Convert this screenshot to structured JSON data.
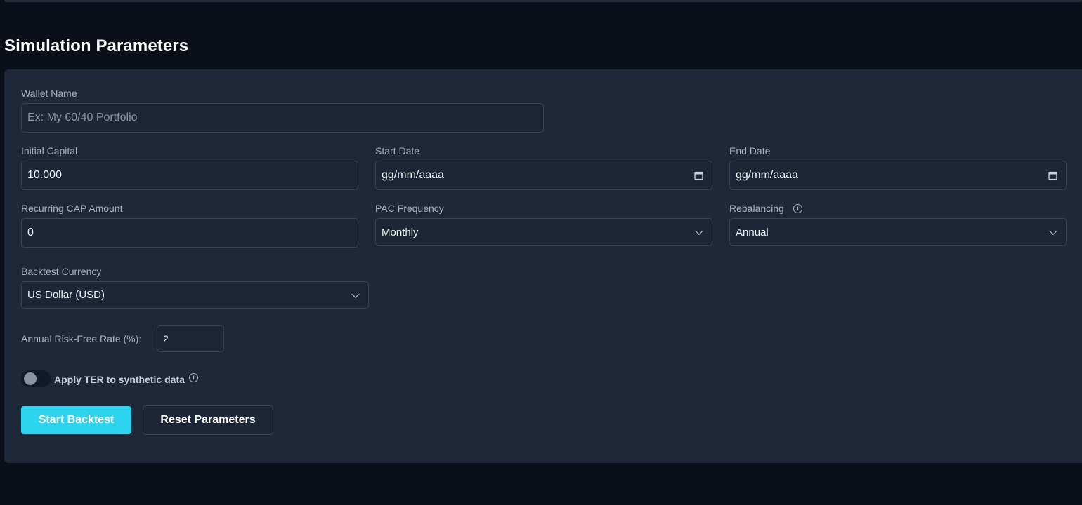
{
  "section_title": "Simulation Parameters",
  "wallet": {
    "label": "Wallet Name",
    "placeholder": "Ex: My 60/40 Portfolio",
    "value": ""
  },
  "initial_capital": {
    "label": "Initial Capital",
    "value": "10.000"
  },
  "start_date": {
    "label": "Start Date",
    "value": "gg/mm/aaaa"
  },
  "end_date": {
    "label": "End Date",
    "value": "gg/mm/aaaa"
  },
  "recurring": {
    "label": "Recurring CAP Amount",
    "value": "0"
  },
  "pac_frequency": {
    "label": "PAC Frequency",
    "value": "Monthly"
  },
  "rebalancing": {
    "label": "Rebalancing",
    "value": "Annual"
  },
  "currency": {
    "label": "Backtest Currency",
    "value": "US Dollar (USD)"
  },
  "risk_free": {
    "label": "Annual Risk-Free Rate (%):",
    "value": "2"
  },
  "ter_toggle": {
    "label": "Apply TER to synthetic data",
    "on": false
  },
  "buttons": {
    "start": "Start Backtest",
    "reset": "Reset Parameters"
  },
  "colors": {
    "accent": "#2dd4ef",
    "panel": "#1f2839",
    "background": "#0b0f19"
  },
  "icons": [
    "calendar-icon",
    "chevron-down-icon",
    "info-icon"
  ]
}
